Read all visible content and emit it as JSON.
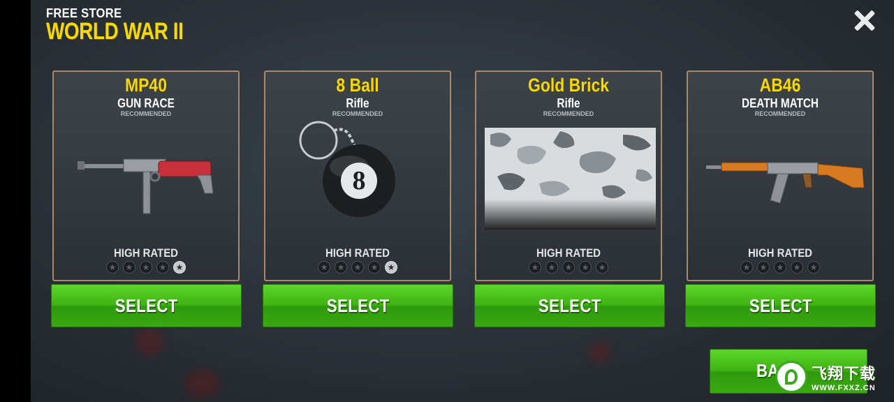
{
  "header": {
    "subtitle": "FREE STORE",
    "title": "WORLD WAR II"
  },
  "cards": [
    {
      "name": "MP40",
      "mode": "GUN RACE",
      "tag": "RECOMMENDED",
      "rating_label": "HIGH RATED",
      "rating": 1,
      "rating_max": 5,
      "image": "mp40-gun-icon",
      "select_label": "SELECT"
    },
    {
      "name": "8 Ball",
      "mode": "Rifle",
      "tag": "RECOMMENDED",
      "rating_label": "HIGH RATED",
      "rating": 1,
      "rating_max": 5,
      "image": "8-ball-keychain-icon",
      "select_label": "SELECT"
    },
    {
      "name": "Gold Brick",
      "mode": "Rifle",
      "tag": "RECOMMENDED",
      "rating_label": "HIGH RATED",
      "rating": 0,
      "rating_max": 5,
      "image": "camo-skin-swatch",
      "select_label": "SELECT"
    },
    {
      "name": "AB46",
      "mode": "DEATH MATCH",
      "tag": "RECOMMENDED",
      "rating_label": "HIGH RATED",
      "rating": 0,
      "rating_max": 5,
      "image": "ak-rifle-icon",
      "select_label": "SELECT"
    }
  ],
  "back_button": {
    "label": "BA"
  },
  "watermark": {
    "cn": "飞翔下载",
    "url": "WWW.FXXZ.CN"
  },
  "colors": {
    "title_yellow": "#f5d900",
    "button_green": "#3fb313",
    "card_border": "#a88a6a"
  }
}
